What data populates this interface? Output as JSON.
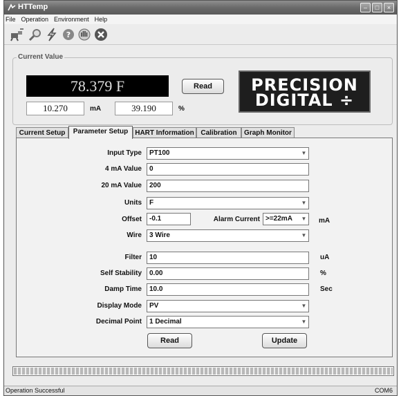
{
  "window": {
    "title": "HTTemp"
  },
  "menu": [
    "File",
    "Operation",
    "Environment",
    "Help"
  ],
  "toolbar": [
    {
      "icon": "connect-icon"
    },
    {
      "icon": "search-icon"
    },
    {
      "icon": "lightning-icon"
    },
    {
      "icon": "help-icon"
    },
    {
      "icon": "hand-icon"
    },
    {
      "icon": "close-icon"
    }
  ],
  "current_value": {
    "legend": "Current Value",
    "display": "78.379 F",
    "ma_value": "10.270",
    "ma_unit": "mA",
    "percent_value": "39.190",
    "percent_unit": "%",
    "read_button": "Read"
  },
  "logo": {
    "line1": "PRECISION",
    "line2": "DIGITAL ÷"
  },
  "tabs": [
    "Current Setup",
    "Parameter Setup",
    "HART Information",
    "Calibration",
    "Graph Monitor"
  ],
  "active_tab": "Parameter Setup",
  "params": {
    "input_type": {
      "label": "Input Type",
      "value": "PT100"
    },
    "ma4": {
      "label": "4 mA Value",
      "value": "0"
    },
    "ma20": {
      "label": "20 mA Value",
      "value": "200"
    },
    "units": {
      "label": "Units",
      "value": "F"
    },
    "offset": {
      "label": "Offset",
      "value": "-0.1"
    },
    "alarm_current": {
      "label": "Alarm Current",
      "value": ">=22mA",
      "unit": "mA"
    },
    "wire": {
      "label": "Wire",
      "value": "3 Wire"
    },
    "filter": {
      "label": "Filter",
      "value": "10",
      "unit": "uA"
    },
    "self_stability": {
      "label": "Self Stability",
      "value": "0.00",
      "unit": "%"
    },
    "damp_time": {
      "label": "Damp Time",
      "value": "10.0",
      "unit": "Sec"
    },
    "display_mode": {
      "label": "Display Mode",
      "value": "PV"
    },
    "decimal_point": {
      "label": "Decimal Point",
      "value": "1 Decimal"
    }
  },
  "buttons": {
    "read": "Read",
    "update": "Update"
  },
  "progress": {
    "fraction": 1.0
  },
  "status": {
    "message": "Operation Successful",
    "port": "COM6"
  }
}
